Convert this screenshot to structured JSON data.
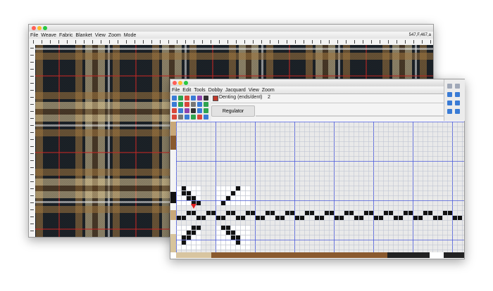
{
  "back_window": {
    "title": "",
    "menu": [
      "File",
      "Weave",
      "Fabric",
      "Blanket",
      "View",
      "Zoom",
      "Mode"
    ],
    "coords": "547,F,467,a",
    "colors": {
      "dark": "#1c2228",
      "tan": "#a57a42",
      "cream": "#e8d09a",
      "red": "#c82a26",
      "white": "#f2f2f2",
      "brown": "#6b4a26"
    }
  },
  "front_window": {
    "title": "",
    "menu": [
      "File",
      "Edit",
      "Tools",
      "Dobby",
      "Jacquard",
      "View",
      "Zoom"
    ],
    "denting_label": "Denting (ends/dent)",
    "denting_value": "2",
    "regulator_label": "Regulator",
    "marker": "red-triangle-marker",
    "status_colors": [
      "#d8c5a0",
      "#8a5a2e",
      "#222222",
      "#ffffff"
    ]
  }
}
